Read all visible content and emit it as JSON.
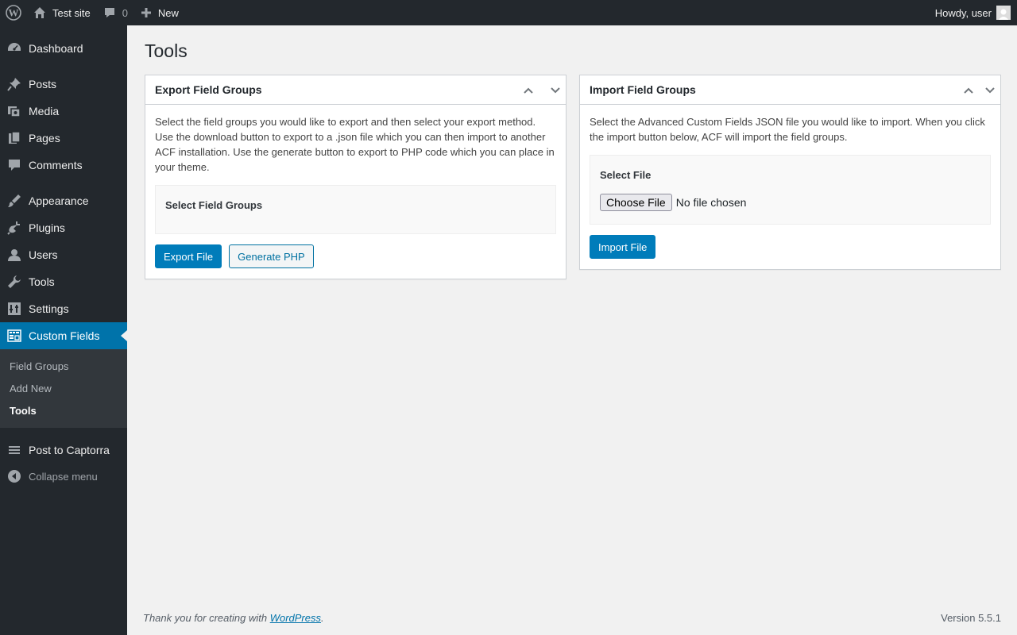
{
  "adminbar": {
    "site_name": "Test site",
    "comments_count": "0",
    "new_label": "New",
    "howdy": "Howdy, user"
  },
  "sidebar": {
    "items": [
      {
        "label": "Dashboard",
        "icon": "dashboard-icon"
      },
      {
        "label": "Posts",
        "icon": "pin-icon"
      },
      {
        "label": "Media",
        "icon": "media-icon"
      },
      {
        "label": "Pages",
        "icon": "pages-icon"
      },
      {
        "label": "Comments",
        "icon": "comment-icon"
      },
      {
        "label": "Appearance",
        "icon": "brush-icon"
      },
      {
        "label": "Plugins",
        "icon": "plug-icon"
      },
      {
        "label": "Users",
        "icon": "user-icon"
      },
      {
        "label": "Tools",
        "icon": "wrench-icon"
      },
      {
        "label": "Settings",
        "icon": "settings-icon"
      },
      {
        "label": "Custom Fields",
        "icon": "table-icon"
      }
    ],
    "submenu": [
      "Field Groups",
      "Add New",
      "Tools"
    ],
    "extra_item": "Post to Captorra",
    "collapse": "Collapse menu"
  },
  "page": {
    "title": "Tools"
  },
  "export_box": {
    "title": "Export Field Groups",
    "description": "Select the field groups you would like to export and then select your export method. Use the download button to export to a .json file which you can then import to another ACF installation. Use the generate button to export to PHP code which you can place in your theme.",
    "field_label": "Select Field Groups",
    "export_button": "Export File",
    "generate_button": "Generate PHP"
  },
  "import_box": {
    "title": "Import Field Groups",
    "description": "Select the Advanced Custom Fields JSON file you would like to import. When you click the import button below, ACF will import the field groups.",
    "field_label": "Select File",
    "choose_button": "Choose File",
    "file_status": "No file chosen",
    "import_button": "Import File"
  },
  "footer": {
    "thanks_prefix": "Thank you for creating with ",
    "wordpress_link": "WordPress",
    "thanks_suffix": ".",
    "version": "Version 5.5.1"
  },
  "colors": {
    "admin_dark": "#23282d",
    "accent": "#0073aa",
    "submenu_bg": "#32373c"
  }
}
